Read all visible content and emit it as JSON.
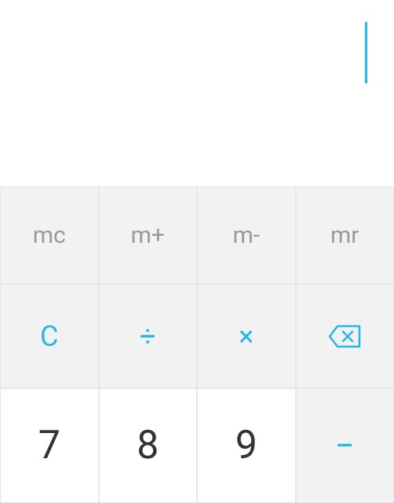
{
  "display": {
    "value": ""
  },
  "memory": {
    "mc": "mc",
    "mplus": "m+",
    "mminus": "m-",
    "mr": "mr"
  },
  "ops": {
    "clear": "C",
    "divide": "÷",
    "multiply": "×",
    "backspace": "backspace"
  },
  "nums": {
    "seven": "7",
    "eight": "8",
    "nine": "9",
    "minus": "−"
  }
}
